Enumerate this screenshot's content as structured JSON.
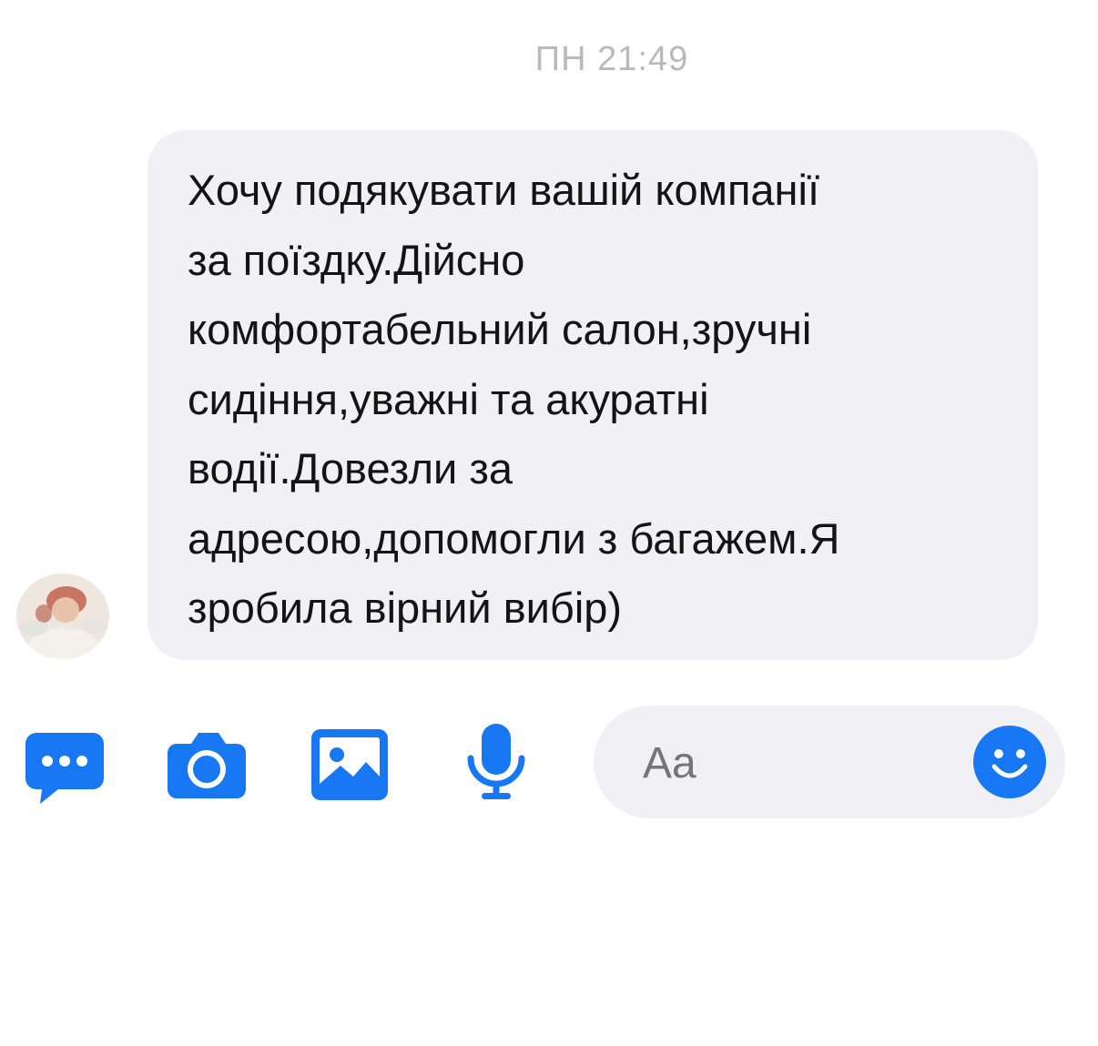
{
  "conversation": {
    "timestamp": "ПН 21:49",
    "message": {
      "lines": [
        "Хочу подякувати вашій компанії",
        "за поїздку.Дійсно",
        "комфортабельний салон,зручні",
        "сидіння,уважні та акуратні",
        "водії.Довезли за",
        "адресою,допомогли з багажем.Я",
        "зробила вірний вибір)"
      ]
    },
    "sender_avatar_icon": "user-avatar"
  },
  "composer": {
    "placeholder": "Aa",
    "actions": [
      {
        "name": "more-actions",
        "icon": "chat-bubble-dots-icon"
      },
      {
        "name": "camera",
        "icon": "camera-icon"
      },
      {
        "name": "gallery",
        "icon": "image-icon"
      },
      {
        "name": "voice",
        "icon": "microphone-icon"
      }
    ],
    "emoji_icon": "smiley-icon"
  },
  "colors": {
    "accent": "#1877f2",
    "bubble_bg": "#f0f0f5",
    "timestamp": "#b9b9bd",
    "message_text": "#141414"
  }
}
